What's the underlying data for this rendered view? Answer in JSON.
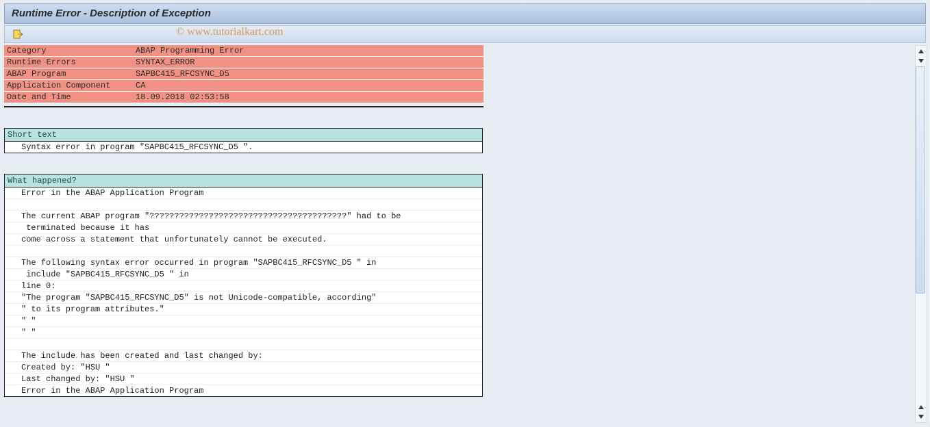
{
  "title": "Runtime Error - Description of Exception",
  "watermark": "© www.tutorialkart.com",
  "info_rows": [
    {
      "label": "Category",
      "value": "ABAP Programming Error"
    },
    {
      "label": "Runtime Errors",
      "value": "SYNTAX_ERROR"
    },
    {
      "label": "ABAP Program",
      "value": "SAPBC415_RFCSYNC_D5"
    },
    {
      "label": "Application Component",
      "value": "CA"
    },
    {
      "label": "Date and Time",
      "value": "18.09.2018 02:53:58"
    }
  ],
  "short_text": {
    "header": "Short text",
    "lines": [
      "Syntax error in program \"SAPBC415_RFCSYNC_D5 \"."
    ]
  },
  "what_happened": {
    "header": "What happened?",
    "lines": [
      "Error in the ABAP Application Program",
      "",
      "The current ABAP program \"????????????????????????????????????????\" had to be",
      " terminated because it has",
      "come across a statement that unfortunately cannot be executed.",
      "",
      "The following syntax error occurred in program \"SAPBC415_RFCSYNC_D5 \" in",
      " include \"SAPBC415_RFCSYNC_D5 \" in",
      "line 0:",
      "\"The program \"SAPBC415_RFCSYNC_D5\" is not Unicode-compatible, according\"",
      "\" to its program attributes.\"",
      "\" \"",
      "\" \"",
      "",
      "The include has been created and last changed by:",
      "Created by: \"HSU \"",
      "Last changed by: \"HSU \"",
      "Error in the ABAP Application Program"
    ]
  }
}
